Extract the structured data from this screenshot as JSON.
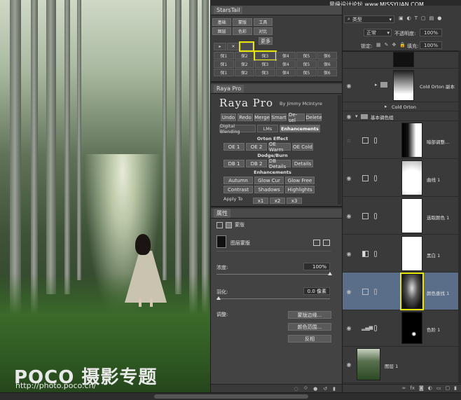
{
  "watermark": "思缘设计论坛 www.MISSYUAN.COM",
  "photo": {
    "logo": "POCO 摄影专题",
    "logo_url": "http://photo.poco.cn/"
  },
  "starstail": {
    "title": "StarsTail",
    "row1": [
      "基础",
      "蒙版",
      "工具"
    ],
    "row2": [
      "图层",
      "色彩",
      "对比"
    ],
    "more": "更多",
    "small": [
      "▸",
      "✕"
    ],
    "grid": [
      "保1",
      "保2",
      "保3",
      "保4",
      "保5",
      "保6",
      "保1",
      "保2",
      "保3",
      "保4",
      "保5",
      "保6",
      "保1",
      "保2",
      "保3",
      "保4",
      "保5",
      "保6",
      "保1",
      "保2",
      "保3",
      "保4",
      "保5",
      "保6"
    ]
  },
  "raya": {
    "tab": "Raya Pro",
    "title": "Raya Pro",
    "by": "By Jimmy McIntyre",
    "row1": [
      "Undo",
      "Redo",
      "Merge",
      "Smart",
      "De-sel",
      "Delete"
    ],
    "tabs": [
      "Digital Blending",
      "LMs",
      "Enhancements"
    ],
    "orton_title": "Orton Effect",
    "orton": [
      "OE 1",
      "OE 2",
      "OE Warm",
      "OE Cold"
    ],
    "dodge_title": "Dodge/Burn",
    "dodge": [
      "DB 1",
      "DB 2",
      "DB Details",
      "Details"
    ],
    "enh_title": "Enhancements",
    "enh1": [
      "Autumn",
      "Glow Cur",
      "Glow Free"
    ],
    "enh2": [
      "Contrast",
      "Shadows",
      "Highlights"
    ],
    "apply": "Apply To",
    "apply_btns": [
      "x1",
      "x2",
      "x3"
    ]
  },
  "props": {
    "tab": "属性",
    "mode": "蒙版",
    "mask_label": "图层蒙版",
    "density_label": "浓度:",
    "density_value": "100%",
    "density_level": 1.0,
    "feather_label": "羽化:",
    "feather_value": "0.0 像素",
    "feather_level": 0.0,
    "adjust_label": "调整:",
    "btn_edge": "蒙版边缘...",
    "btn_range": "颜色范围...",
    "btn_invert": "反相"
  },
  "layers": {
    "filter": "类型",
    "blend_mode": "正常",
    "opacity_label": "不透明度:",
    "opacity_value": "100%",
    "lock_label": "锁定:",
    "fill_label": "填充:",
    "fill_value": "100%",
    "items": [
      {
        "name": "Cold Orton 副本",
        "type": "group"
      },
      {
        "name": "Cold Orton",
        "type": "group"
      },
      {
        "name": "基本调色组",
        "type": "group-open"
      },
      {
        "name": "暗部调整...",
        "type": "adjust"
      },
      {
        "name": "曲线 1",
        "type": "adjust"
      },
      {
        "name": "选取颜色 1",
        "type": "adjust"
      },
      {
        "name": "黑白 1",
        "type": "adjust"
      },
      {
        "name": "颜色查找 1",
        "type": "adjust",
        "selected": true
      },
      {
        "name": "色阶 1",
        "type": "adjust"
      },
      {
        "name": "图层 1",
        "type": "pixel"
      }
    ],
    "bottom_icons": [
      "link-icon",
      "fx-icon",
      "mask-icon",
      "adjustment-icon",
      "folder-icon",
      "new-layer-icon",
      "trash-icon"
    ]
  },
  "colors": {
    "highlight": "#e6e600",
    "selected_layer": "#5a6d89",
    "panel": "#3a3a3a"
  }
}
